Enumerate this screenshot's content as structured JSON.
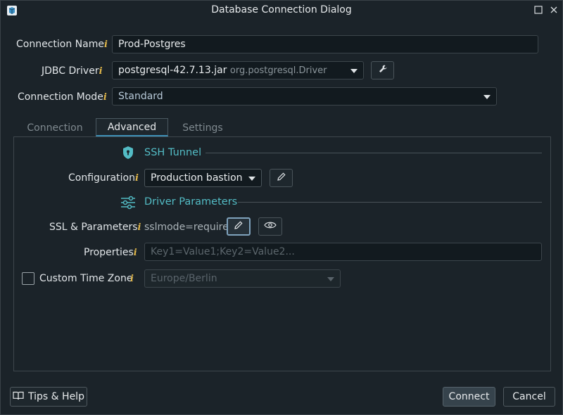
{
  "window": {
    "title": "Database Connection Dialog"
  },
  "form": {
    "connection_name_label": "Connection Name",
    "connection_name_value": "Prod-Postgres",
    "jdbc_driver_label": "JDBC Driver",
    "jdbc_driver_jar": "postgresql-42.7.13.jar",
    "jdbc_driver_class": "org.postgresql.Driver",
    "connection_mode_label": "Connection Mode",
    "connection_mode_value": "Standard",
    "info_glyph": "i"
  },
  "tabs": [
    {
      "label": "Connection",
      "active": false
    },
    {
      "label": "Advanced",
      "active": true
    },
    {
      "label": "Settings",
      "active": false
    }
  ],
  "advanced": {
    "ssh_section_title": "SSH Tunnel",
    "configuration_label": "Configuration",
    "configuration_value": "Production bastion",
    "driver_section_title": "Driver Parameters",
    "ssl_label": "SSL & Parameters",
    "ssl_value": "sslmode=require",
    "properties_label": "Properties",
    "properties_placeholder": "Key1=Value1;Key2=Value2...",
    "custom_tz_label": "Custom Time Zone",
    "custom_tz_checked": false,
    "timezone_value": "Europe/Berlin"
  },
  "footer": {
    "tips_label": "Tips & Help",
    "connect_label": "Connect",
    "cancel_label": "Cancel"
  },
  "colors": {
    "background": "#1b2329",
    "accent_teal": "#53bcc5",
    "info_yellow": "#e0b64a",
    "tab_underline": "#3d8fb5"
  },
  "icons": {
    "app": "database-app-icon",
    "maximize": "maximize-icon",
    "close": "close-icon",
    "driver_settings": "wrench-icon",
    "ssh": "shield-icon",
    "driver_params": "sliders-icon",
    "edit": "pencil-icon",
    "view": "eye-icon",
    "help": "book-icon"
  }
}
